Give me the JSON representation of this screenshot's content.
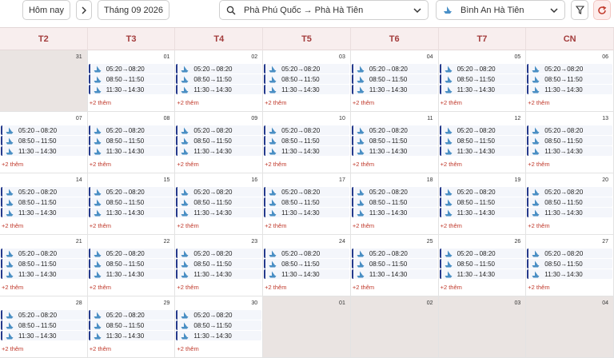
{
  "toolbar": {
    "today_label": "Hôm nay",
    "month_label": "Tháng 09 2026",
    "route_label": "Phà Phú Quốc → Phà Hà Tiên",
    "company_label": "Bình An Hà Tiên",
    "icons": {
      "prev": "chevron-left-icon",
      "next": "chevron-right-icon",
      "search": "search-icon",
      "dropdown": "chevron-down-icon",
      "filter": "filter-icon",
      "refresh": "refresh-icon",
      "ship": "ship-icon"
    }
  },
  "colors": {
    "header_bg": "#f8eeee",
    "header_text": "#a33c3c",
    "trip_accent": "#253a8c",
    "more_text": "#c0392b",
    "disabled_bg": "#eae4e2"
  },
  "weekdays": [
    "T2",
    "T3",
    "T4",
    "T5",
    "T6",
    "T7",
    "CN"
  ],
  "weeks": [
    [
      {
        "day": "31",
        "enabled": false,
        "trips": [],
        "more": ""
      },
      {
        "day": "01",
        "enabled": true,
        "trips": [
          "05:20→08:20",
          "08:50→11:50",
          "11:30→14:30"
        ],
        "more": "+2 thêm"
      },
      {
        "day": "02",
        "enabled": true,
        "trips": [
          "05:20→08:20",
          "08:50→11:50",
          "11:30→14:30"
        ],
        "more": "+2 thêm"
      },
      {
        "day": "03",
        "enabled": true,
        "trips": [
          "05:20→08:20",
          "08:50→11:50",
          "11:30→14:30"
        ],
        "more": "+2 thêm"
      },
      {
        "day": "04",
        "enabled": true,
        "trips": [
          "05:20→08:20",
          "08:50→11:50",
          "11:30→14:30"
        ],
        "more": "+2 thêm"
      },
      {
        "day": "05",
        "enabled": true,
        "trips": [
          "05:20→08:20",
          "08:50→11:50",
          "11:30→14:30"
        ],
        "more": "+2 thêm"
      },
      {
        "day": "06",
        "enabled": true,
        "trips": [
          "05:20→08:20",
          "08:50→11:50",
          "11:30→14:30"
        ],
        "more": "+2 thêm"
      }
    ],
    [
      {
        "day": "07",
        "enabled": true,
        "trips": [
          "05:20→08:20",
          "08:50→11:50",
          "11:30→14:30"
        ],
        "more": "+2 thêm"
      },
      {
        "day": "08",
        "enabled": true,
        "trips": [
          "05:20→08:20",
          "08:50→11:50",
          "11:30→14:30"
        ],
        "more": "+2 thêm"
      },
      {
        "day": "09",
        "enabled": true,
        "trips": [
          "05:20→08:20",
          "08:50→11:50",
          "11:30→14:30"
        ],
        "more": "+2 thêm"
      },
      {
        "day": "10",
        "enabled": true,
        "trips": [
          "05:20→08:20",
          "08:50→11:50",
          "11:30→14:30"
        ],
        "more": "+2 thêm"
      },
      {
        "day": "11",
        "enabled": true,
        "trips": [
          "05:20→08:20",
          "08:50→11:50",
          "11:30→14:30"
        ],
        "more": "+2 thêm"
      },
      {
        "day": "12",
        "enabled": true,
        "trips": [
          "05:20→08:20",
          "08:50→11:50",
          "11:30→14:30"
        ],
        "more": "+2 thêm"
      },
      {
        "day": "13",
        "enabled": true,
        "trips": [
          "05:20→08:20",
          "08:50→11:50",
          "11:30→14:30"
        ],
        "more": "+2 thêm"
      }
    ],
    [
      {
        "day": "14",
        "enabled": true,
        "trips": [
          "05:20→08:20",
          "08:50→11:50",
          "11:30→14:30"
        ],
        "more": "+2 thêm"
      },
      {
        "day": "15",
        "enabled": true,
        "trips": [
          "05:20→08:20",
          "08:50→11:50",
          "11:30→14:30"
        ],
        "more": "+2 thêm"
      },
      {
        "day": "16",
        "enabled": true,
        "trips": [
          "05:20→08:20",
          "08:50→11:50",
          "11:30→14:30"
        ],
        "more": "+2 thêm"
      },
      {
        "day": "17",
        "enabled": true,
        "trips": [
          "05:20→08:20",
          "08:50→11:50",
          "11:30→14:30"
        ],
        "more": "+2 thêm"
      },
      {
        "day": "18",
        "enabled": true,
        "trips": [
          "05:20→08:20",
          "08:50→11:50",
          "11:30→14:30"
        ],
        "more": "+2 thêm"
      },
      {
        "day": "19",
        "enabled": true,
        "trips": [
          "05:20→08:20",
          "08:50→11:50",
          "11:30→14:30"
        ],
        "more": "+2 thêm"
      },
      {
        "day": "20",
        "enabled": true,
        "trips": [
          "05:20→08:20",
          "08:50→11:50",
          "11:30→14:30"
        ],
        "more": "+2 thêm"
      }
    ],
    [
      {
        "day": "21",
        "enabled": true,
        "trips": [
          "05:20→08:20",
          "08:50→11:50",
          "11:30→14:30"
        ],
        "more": "+2 thêm"
      },
      {
        "day": "22",
        "enabled": true,
        "trips": [
          "05:20→08:20",
          "08:50→11:50",
          "11:30→14:30"
        ],
        "more": "+2 thêm"
      },
      {
        "day": "23",
        "enabled": true,
        "trips": [
          "05:20→08:20",
          "08:50→11:50",
          "11:30→14:30"
        ],
        "more": "+2 thêm"
      },
      {
        "day": "24",
        "enabled": true,
        "trips": [
          "05:20→08:20",
          "08:50→11:50",
          "11:30→14:30"
        ],
        "more": "+2 thêm"
      },
      {
        "day": "25",
        "enabled": true,
        "trips": [
          "05:20→08:20",
          "08:50→11:50",
          "11:30→14:30"
        ],
        "more": "+2 thêm"
      },
      {
        "day": "26",
        "enabled": true,
        "trips": [
          "05:20→08:20",
          "08:50→11:50",
          "11:30→14:30"
        ],
        "more": "+2 thêm"
      },
      {
        "day": "27",
        "enabled": true,
        "trips": [
          "05:20→08:20",
          "08:50→11:50",
          "11:30→14:30"
        ],
        "more": "+2 thêm"
      }
    ],
    [
      {
        "day": "28",
        "enabled": true,
        "trips": [
          "05:20→08:20",
          "08:50→11:50",
          "11:30→14:30"
        ],
        "more": "+2 thêm"
      },
      {
        "day": "29",
        "enabled": true,
        "trips": [
          "05:20→08:20",
          "08:50→11:50",
          "11:30→14:30"
        ],
        "more": "+2 thêm"
      },
      {
        "day": "30",
        "enabled": true,
        "trips": [
          "05:20→08:20",
          "08:50→11:50",
          "11:30→14:30"
        ],
        "more": "+2 thêm"
      },
      {
        "day": "01",
        "enabled": false,
        "trips": [],
        "more": ""
      },
      {
        "day": "02",
        "enabled": false,
        "trips": [],
        "more": ""
      },
      {
        "day": "03",
        "enabled": false,
        "trips": [],
        "more": ""
      },
      {
        "day": "04",
        "enabled": false,
        "trips": [],
        "more": ""
      }
    ]
  ]
}
